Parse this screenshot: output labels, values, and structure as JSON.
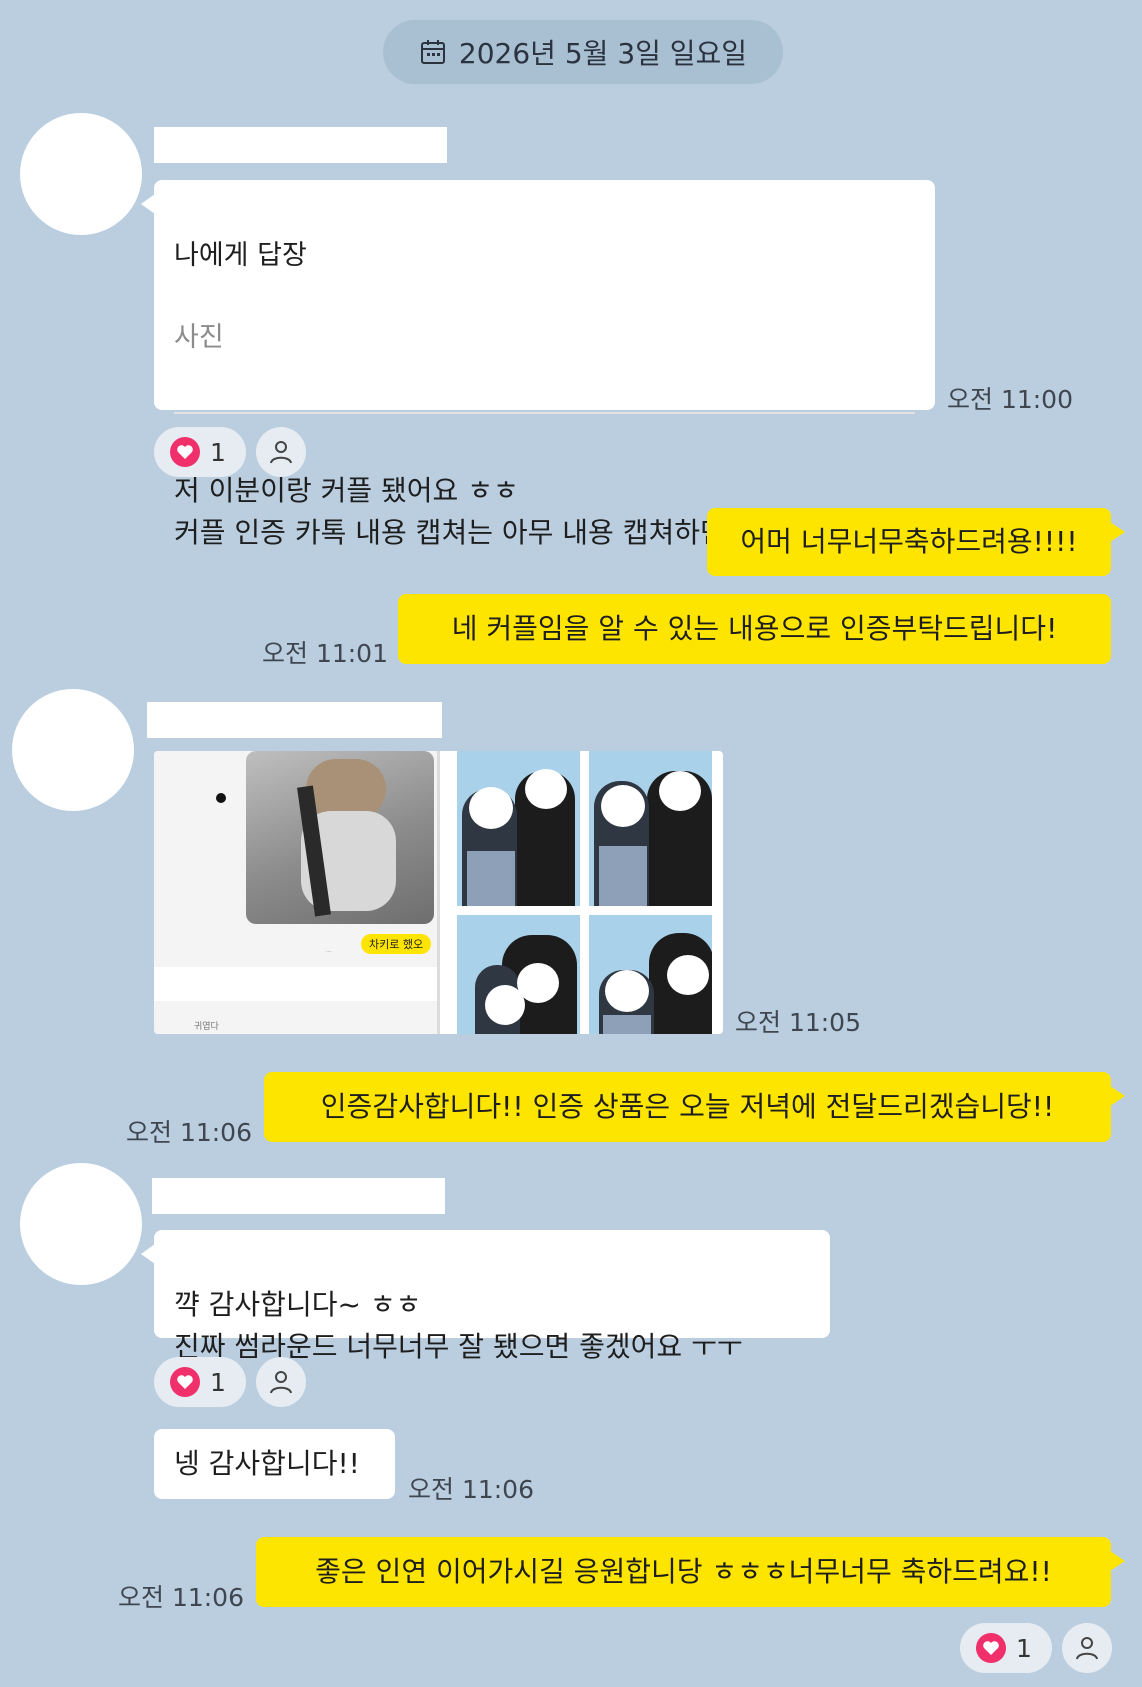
{
  "date_pill": {
    "text": "2026년 5월 3일 일요일",
    "icon": "calendar-icon"
  },
  "messages": {
    "m1": {
      "reply_title": "나에게 답장",
      "reply_sub": "사진",
      "text": "저 이분이랑 커플 됐어요 ㅎㅎ\n커플 인증 카톡 내용 캡쳐는 아무 내용 캡쳐하면 되나요??",
      "time": "오전 11:00",
      "reaction_count": "1"
    },
    "m2": {
      "text": "어머 너무너무축하드려용!!!!"
    },
    "m3": {
      "text": "네 커플임을 알 수 있는 내용으로 인증부탁드립니다!",
      "time": "오전 11:01"
    },
    "m4": {
      "time": "오전 11:05",
      "photo_caption": "차키로 했오",
      "photo_small": "귀엽다"
    },
    "m5": {
      "text": "인증감사합니다!! 인증 상품은 오늘 저녁에 전달드리겠습니당!!",
      "time": "오전 11:06"
    },
    "m6": {
      "text": "꺅 감사합니다~ ㅎㅎ\n진짜 썸라운드 너무너무 잘 됐으면 좋겠어요 ㅜㅜ",
      "reaction_count": "1"
    },
    "m7": {
      "text": "넹 감사합니다!!",
      "time": "오전 11:06"
    },
    "m8": {
      "text": "좋은 인연 이어가시길 응원합니당 ㅎㅎㅎ너무너무 축하드려요!!",
      "time": "오전 11:06",
      "reaction_count": "1"
    }
  },
  "colors": {
    "background": "#bacee0",
    "my_bubble": "#fee500",
    "their_bubble": "#ffffff",
    "heart": "#f0306b"
  }
}
